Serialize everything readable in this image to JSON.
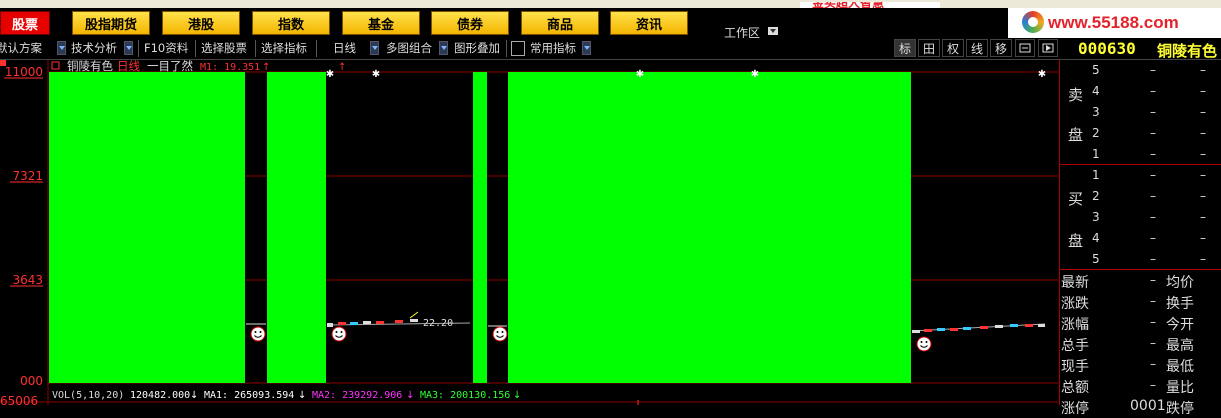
{
  "nav": {
    "items": [
      {
        "label": "股票",
        "active": true
      },
      {
        "label": "股指期货",
        "active": false
      },
      {
        "label": "港股",
        "active": false
      },
      {
        "label": "指数",
        "active": false
      },
      {
        "label": "基金",
        "active": false
      },
      {
        "label": "债券",
        "active": false
      },
      {
        "label": "商品",
        "active": false
      },
      {
        "label": "资讯",
        "active": false
      }
    ],
    "workzone": "工作区",
    "logo": "www.55188.com",
    "ad": "金买超人智慧"
  },
  "toolbar": {
    "scheme": "默认方案",
    "tech": "技术分析",
    "f10": "F10资料",
    "select_stock": "选择股票",
    "select_indicator": "选择指标",
    "period": "日线",
    "multi": "多图组合",
    "overlay": "图形叠加",
    "common": "常用指标",
    "right_buttons": [
      "标",
      "田",
      "权",
      "线",
      "移"
    ]
  },
  "stock": {
    "code": "000630",
    "name": "铜陵有色"
  },
  "chart_header": {
    "name": "铜陵有色",
    "period": "日线",
    "mode": "一目了然",
    "m1": "M1: 19.351"
  },
  "price_marker": "22.20",
  "vol_header": {
    "label": "VOL(5,10,20)",
    "vol": "120482.000",
    "ma1": "MA1: 265093.594",
    "ma2": "MA2: 239292.906",
    "ma3": "MA3: 200130.156"
  },
  "colors": {
    "green": "#00ff00",
    "grid": "#8b0000",
    "axis_text": "#ff3030",
    "ma1": "#ffffff",
    "ma2": "#ff33ff",
    "ma3": "#33ff33"
  },
  "chart_data": {
    "type": "bar",
    "ylabels": [
      "11000",
      "7321",
      "3643",
      "000"
    ],
    "ylim": [
      0,
      11000
    ],
    "vol_axis_label": "65006",
    "bars": [
      {
        "x": 49,
        "w": 196,
        "value": 11000
      },
      {
        "x": 267,
        "w": 59,
        "value": 11000
      },
      {
        "x": 473,
        "w": 14,
        "value": 11000
      },
      {
        "x": 508,
        "w": 403,
        "value": 11000
      }
    ],
    "smileys": [
      258,
      339,
      500,
      924
    ]
  },
  "panel": {
    "sell_label": [
      "卖",
      "盘"
    ],
    "buy_label": [
      "买",
      "盘"
    ],
    "sell_levels": [
      "5",
      "4",
      "3",
      "2",
      "1"
    ],
    "buy_levels": [
      "1",
      "2",
      "3",
      "4",
      "5"
    ],
    "dash": "–",
    "quotes": [
      {
        "l": "最新",
        "r": "均价"
      },
      {
        "l": "涨跌",
        "r": "换手"
      },
      {
        "l": "涨幅",
        "r": "今开"
      },
      {
        "l": "总手",
        "r": "最高"
      },
      {
        "l": "现手",
        "r": "最低"
      },
      {
        "l": "总额",
        "r": "量比"
      },
      {
        "l": "涨停",
        "r": "跌停"
      }
    ],
    "partial_val": "0001"
  }
}
